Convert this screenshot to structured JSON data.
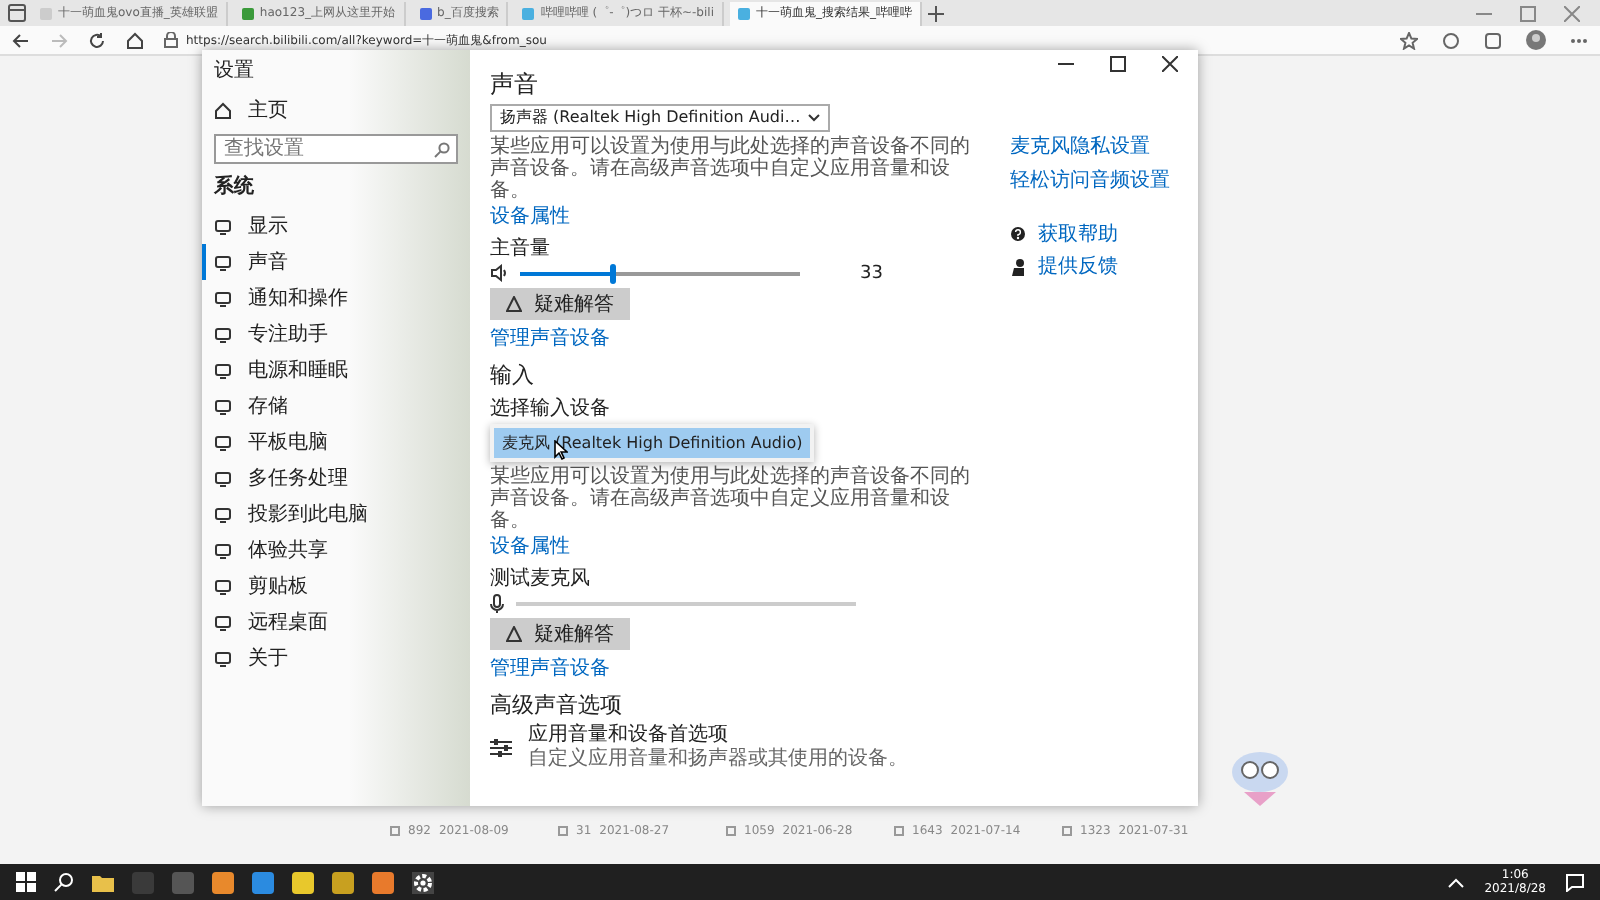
{
  "browser": {
    "tabs": [
      {
        "title": "十一萌血鬼ovo直播_英雄联盟",
        "selected": false
      },
      {
        "title": "hao123_上网从这里开始",
        "selected": false
      },
      {
        "title": "b_百度搜索",
        "selected": false
      },
      {
        "title": "哔哩哔哩 (゜-゜)つロ 干杯~-bili",
        "selected": false
      },
      {
        "title": "十一萌血鬼_搜索结果_哔哩哔",
        "selected": true
      }
    ],
    "address": "https://search.bilibili.com/all?keyword=十一萌血鬼&from_sou"
  },
  "settings": {
    "title": "设置",
    "sidebar": {
      "home": "主页",
      "search": {
        "placeholder": "查找设置"
      },
      "section": "系统",
      "items": [
        {
          "label": "显示",
          "selected": false
        },
        {
          "label": "声音",
          "selected": true
        },
        {
          "label": "通知和操作",
          "selected": false
        },
        {
          "label": "专注助手",
          "selected": false
        },
        {
          "label": "电源和睡眠",
          "selected": false
        },
        {
          "label": "存储",
          "selected": false
        },
        {
          "label": "平板电脑",
          "selected": false
        },
        {
          "label": "多任务处理",
          "selected": false
        },
        {
          "label": "投影到此电脑",
          "selected": false
        },
        {
          "label": "体验共享",
          "selected": false
        },
        {
          "label": "剪贴板",
          "selected": false
        },
        {
          "label": "远程桌面",
          "selected": false
        },
        {
          "label": "关于",
          "selected": false
        }
      ]
    },
    "heading": "声音",
    "output": {
      "device": "扬声器 (Realtek High Definition Audi…",
      "note": "某些应用可以设置为使用与此处选择的声音设备不同的声音设备。请在高级声音选项中自定义应用音量和设备。",
      "properties_link": "设备属性",
      "volume_label": "主音量",
      "level": 0.33,
      "reading": "33",
      "troubleshoot": "疑难解答",
      "manage_link": "管理声音设备"
    },
    "input": {
      "heading": "输入",
      "choose_label": "选择输入设备",
      "options": [
        {
          "label": "麦克风 (Realtek High Definition Audio)",
          "selected": true
        }
      ],
      "note": "某些应用可以设置为使用与此处选择的声音设备不同的声音设备。请在高级声音选项中自定义应用音量和设备。",
      "properties_link": "设备属性",
      "test_label": "测试麦克风",
      "level": 0,
      "troubleshoot": "疑难解答",
      "manage_link": "管理声音设备"
    },
    "advanced": {
      "heading": "高级声音选项",
      "item_title": "应用音量和设备首选项",
      "item_desc": "自定义应用音量和扬声器或其使用的设备。"
    },
    "related": [
      {
        "label": "麦克风隐私设置"
      },
      {
        "label": "轻松访问音频设置"
      }
    ],
    "help": [
      {
        "kind": "help",
        "label": "获取帮助"
      },
      {
        "kind": "feedback",
        "label": "提供反馈"
      }
    ]
  },
  "video_cards": [
    {
      "views": "892",
      "date": "2021-08-09"
    },
    {
      "views": "31",
      "date": "2021-08-27"
    },
    {
      "views": "1059",
      "date": "2021-06-28"
    },
    {
      "views": "1643",
      "date": "2021-07-14"
    },
    {
      "views": "1323",
      "date": "2021-07-31"
    }
  ],
  "taskbar": {
    "time": "1:06",
    "date": "2021/8/28"
  }
}
